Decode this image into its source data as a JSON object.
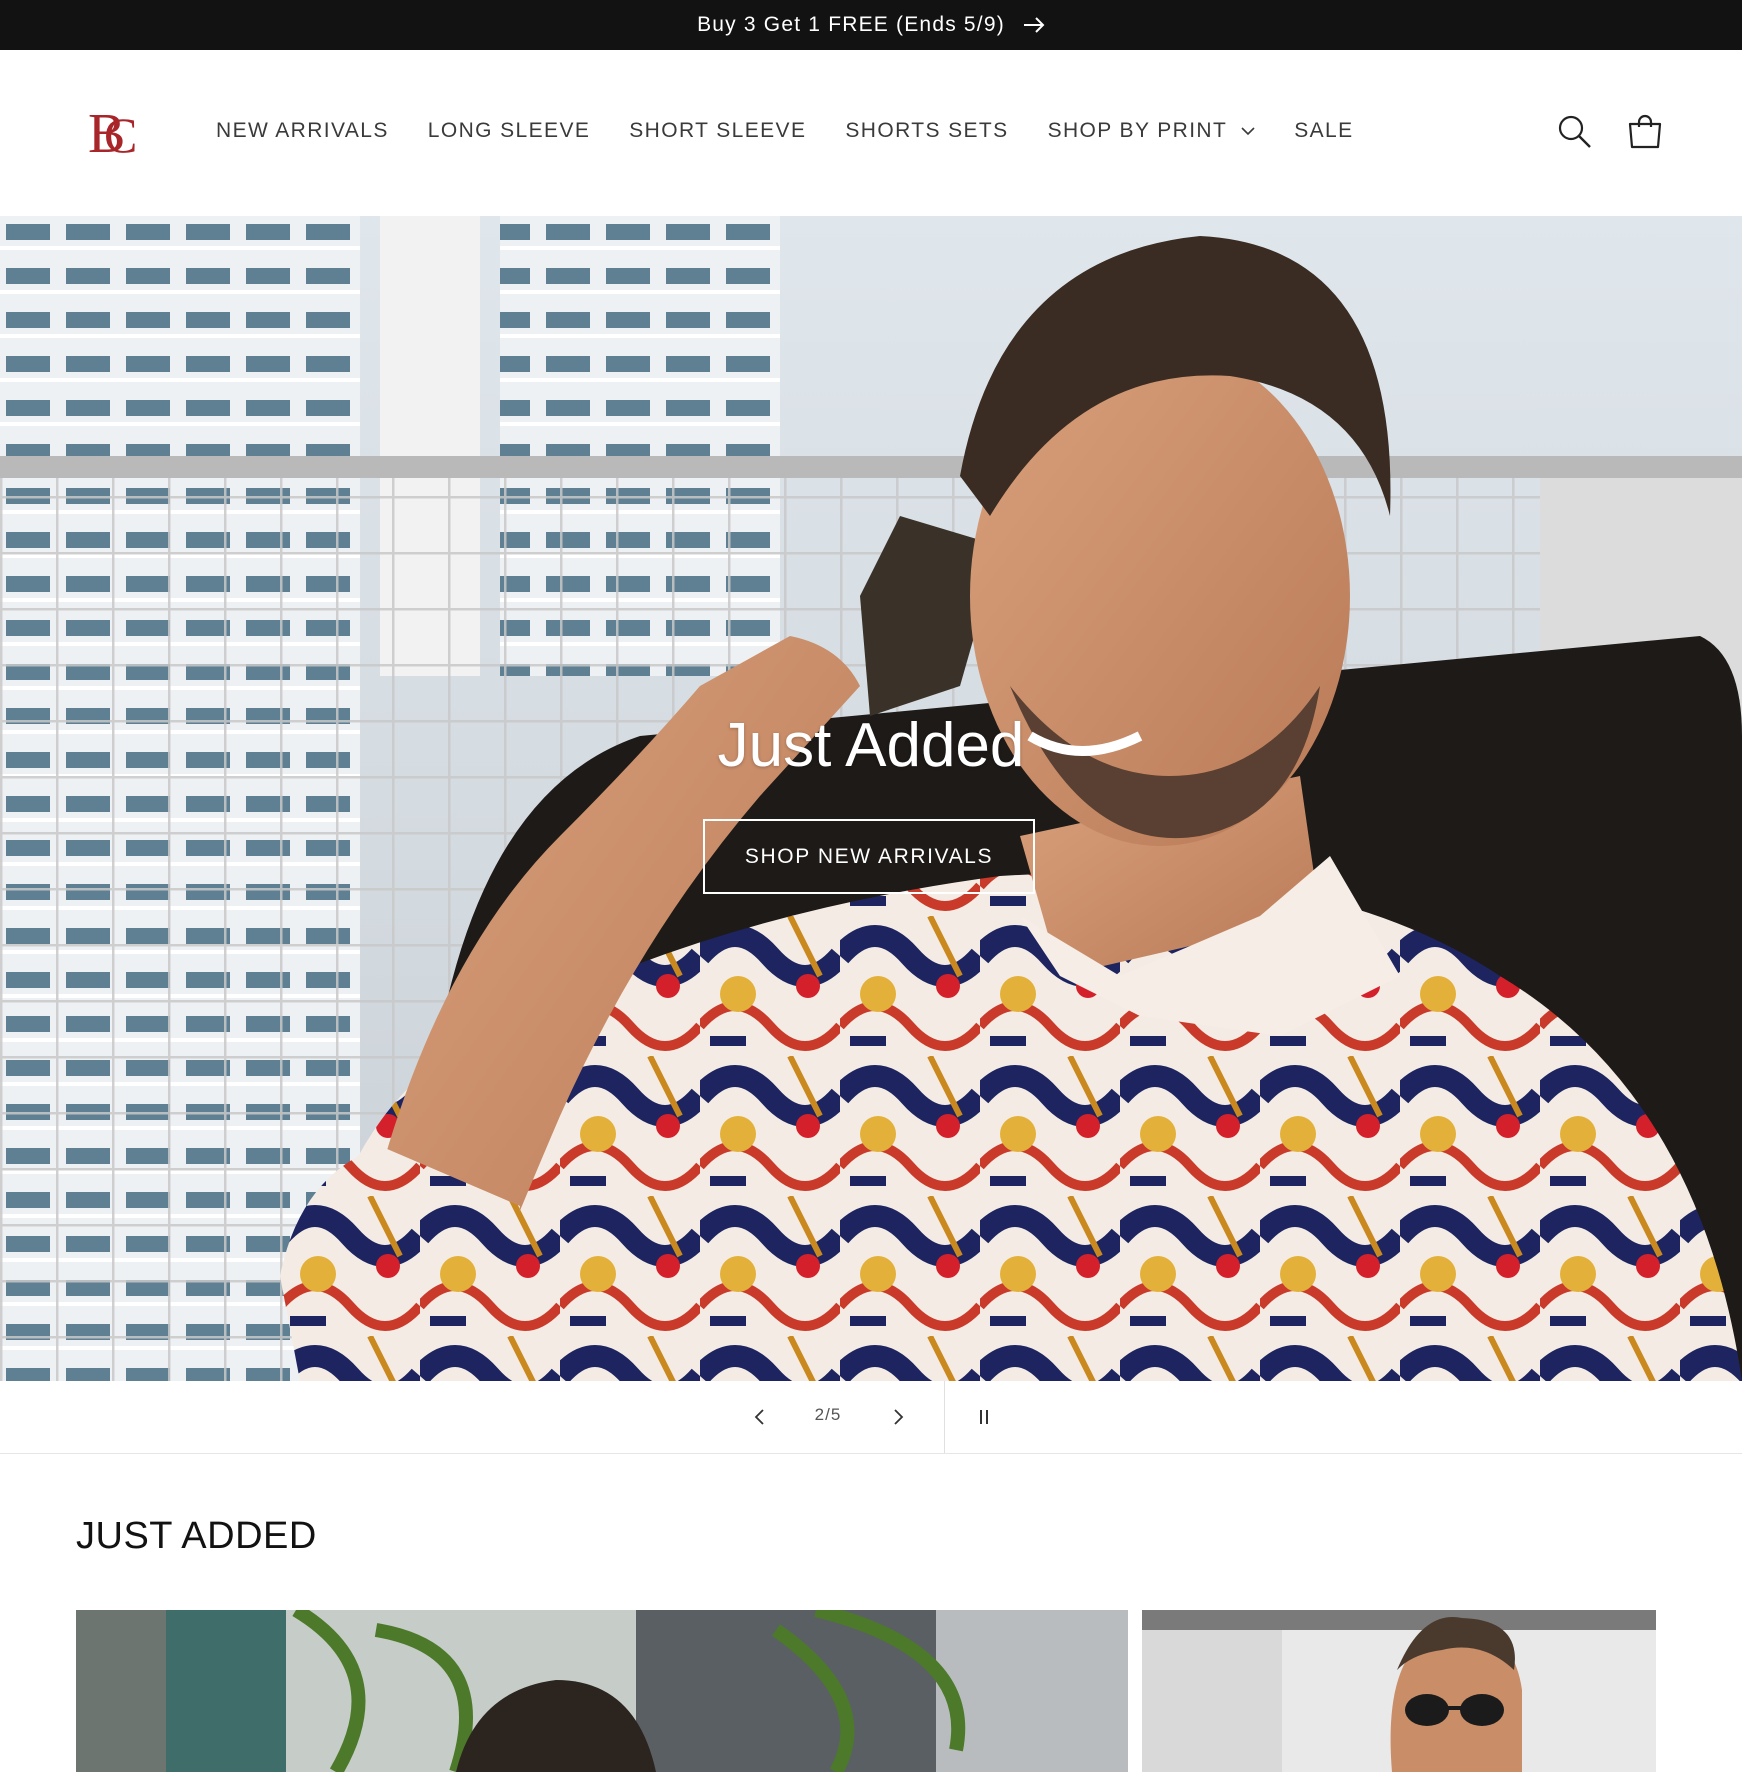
{
  "announcement": {
    "text": "Buy 3 Get 1 FREE (Ends 5/9)",
    "arrow_icon": "arrow-right-icon"
  },
  "header": {
    "logo_text": "BC",
    "nav": [
      {
        "label": "NEW ARRIVALS"
      },
      {
        "label": "LONG SLEEVE"
      },
      {
        "label": "SHORT SLEEVE"
      },
      {
        "label": "SHORTS SETS"
      },
      {
        "label": "SHOP BY PRINT",
        "dropdown": true
      },
      {
        "label": "SALE"
      }
    ],
    "icons": [
      "search-icon",
      "cart-icon"
    ]
  },
  "hero": {
    "title": "Just Added",
    "button_label": "SHOP NEW ARRIVALS"
  },
  "slider": {
    "counter": "2/5"
  },
  "collection": {
    "title": "JUST ADDED"
  },
  "colors": {
    "announcement_bg": "#121212",
    "logo": "#a8262a"
  }
}
